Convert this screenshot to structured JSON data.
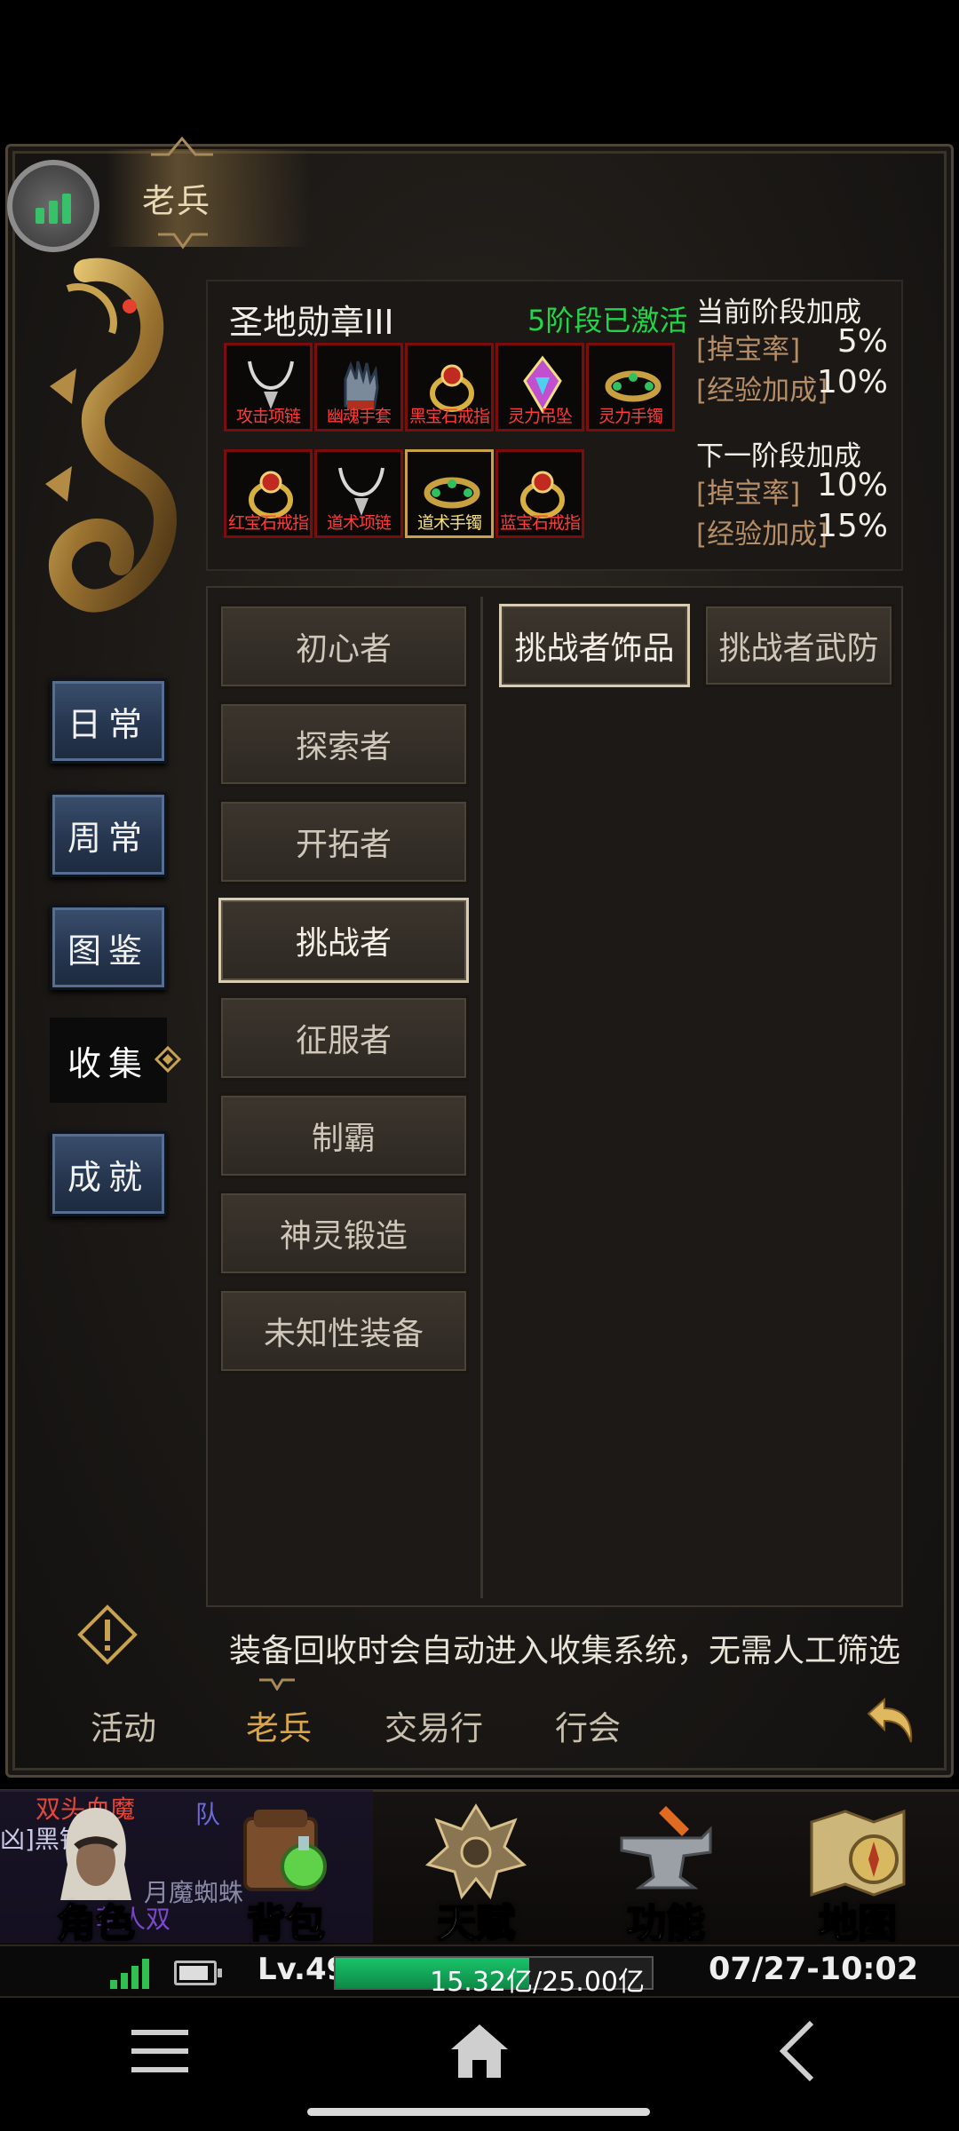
{
  "window": {
    "title": "老兵"
  },
  "nav": [
    {
      "label": "日常",
      "active": false
    },
    {
      "label": "周常",
      "active": false
    },
    {
      "label": "图鉴",
      "active": false
    },
    {
      "label": "收集",
      "active": true
    },
    {
      "label": "成就",
      "active": false
    }
  ],
  "medal": {
    "name": "圣地勋章III",
    "status": "5阶段已激活",
    "slots": [
      {
        "label": "攻击项链",
        "icon": "necklace-icon"
      },
      {
        "label": "幽魂手套",
        "icon": "glove-icon"
      },
      {
        "label": "黑宝石戒指",
        "icon": "ring-icon"
      },
      {
        "label": "灵力吊坠",
        "icon": "pendant-icon"
      },
      {
        "label": "灵力手镯",
        "icon": "bracelet-icon"
      },
      {
        "label": "红宝石戒指",
        "icon": "ring-icon"
      },
      {
        "label": "道术项链",
        "icon": "necklace-icon"
      },
      {
        "label": "道术手镯",
        "icon": "bracelet-icon",
        "highlight": true
      },
      {
        "label": "蓝宝石戒指",
        "icon": "ring-icon"
      }
    ]
  },
  "bonus": {
    "current_title": "当前阶段加成",
    "current": [
      {
        "key": "[掉宝率]",
        "value": "5%"
      },
      {
        "key": "[经验加成]",
        "value": "10%"
      }
    ],
    "next_title": "下一阶段加成",
    "next": [
      {
        "key": "[掉宝率]",
        "value": "10%"
      },
      {
        "key": "[经验加成]",
        "value": "15%"
      }
    ]
  },
  "categories": [
    "初心者",
    "探索者",
    "开拓者",
    "挑战者",
    "征服者",
    "制霸",
    "神灵锻造",
    "未知性装备"
  ],
  "selected_category": "挑战者",
  "subtabs": [
    "挑战者饰品",
    "挑战者武防"
  ],
  "selected_subtab": "挑战者饰品",
  "tip": "装备回收时会自动进入收集系统，无需人工筛选",
  "bottom_tabs": [
    "活动",
    "老兵",
    "交易行",
    "行会"
  ],
  "selected_bottom_tab": "老兵",
  "chat": {
    "line1": "双头血魔",
    "line1b": "队",
    "line2": "凶]黑锷",
    "line3": "月魔蜘蛛",
    "line4": "草人双"
  },
  "game_buttons": [
    {
      "label": "角色",
      "icon": "character-icon"
    },
    {
      "label": "背包",
      "icon": "bag-icon"
    },
    {
      "label": "天赋",
      "icon": "talent-icon"
    },
    {
      "label": "功能",
      "icon": "anvil-icon"
    },
    {
      "label": "地图",
      "icon": "map-icon"
    }
  ],
  "status": {
    "level": "Lv.49",
    "xp_text": "15.32亿/25.00亿",
    "xp_fraction": 0.613,
    "clock": "07/27-10:02"
  },
  "colors": {
    "active_green": "#22d64a",
    "accent_gold": "#d9a54a",
    "slot_red": "#7b0d0d",
    "nav_blue": "#26364f"
  }
}
